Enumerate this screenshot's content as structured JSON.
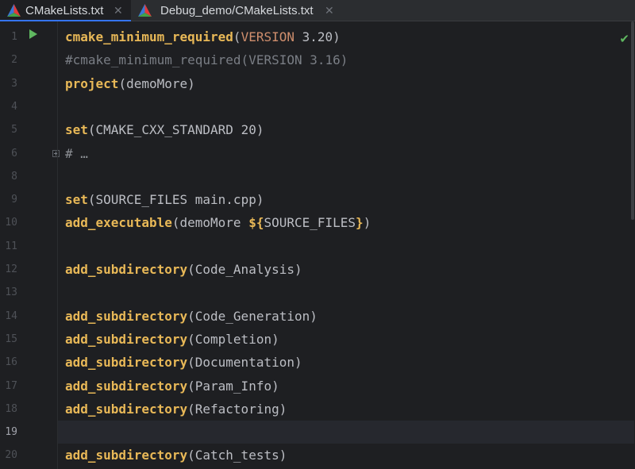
{
  "tabs": [
    {
      "label": "CMakeLists.txt",
      "icon": "cmake-icon",
      "active": true,
      "close": "✕"
    },
    {
      "label": "Debug_demo/CMakeLists.txt",
      "icon": "cmake-icon",
      "active": false,
      "close": "✕"
    }
  ],
  "colors": {
    "function": "#e8b857",
    "keyword": "#cf8e6d",
    "comment": "#7a7e85",
    "variable": "#c77dbb",
    "text": "#bcbec4",
    "run_icon": "#5fb760",
    "background": "#1e1f22"
  },
  "editor": {
    "current_line": "19",
    "inspection_status": "✔",
    "lines": [
      {
        "num": "1",
        "tokens": [
          {
            "t": "cmake_minimum_required",
            "c": "fn"
          },
          {
            "t": "(",
            "c": ""
          },
          {
            "t": "VERSION",
            "c": "kw"
          },
          {
            "t": " 3.20)",
            "c": ""
          }
        ]
      },
      {
        "num": "2",
        "tokens": [
          {
            "t": "#cmake_minimum_required(VERSION 3.16)",
            "c": "cm"
          }
        ]
      },
      {
        "num": "3",
        "tokens": [
          {
            "t": "project",
            "c": "fn"
          },
          {
            "t": "(demoMore)",
            "c": ""
          }
        ]
      },
      {
        "num": "4",
        "tokens": []
      },
      {
        "num": "5",
        "tokens": [
          {
            "t": "set",
            "c": "fn"
          },
          {
            "t": "(CMAKE_CXX_STANDARD 20)",
            "c": ""
          }
        ]
      },
      {
        "num": "6",
        "tokens": [
          {
            "t": "# …",
            "c": "fold-placeholder"
          }
        ]
      },
      {
        "num": "8",
        "tokens": []
      },
      {
        "num": "9",
        "tokens": [
          {
            "t": "set",
            "c": "fn"
          },
          {
            "t": "(SOURCE_FILES main.cpp)",
            "c": ""
          }
        ]
      },
      {
        "num": "10",
        "tokens": [
          {
            "t": "add_executable",
            "c": "fn"
          },
          {
            "t": "(demoMore ",
            "c": ""
          },
          {
            "t": "${",
            "c": "fn"
          },
          {
            "t": "SOURCE_FILES",
            "c": ""
          },
          {
            "t": "}",
            "c": "fn"
          },
          {
            "t": ")",
            "c": ""
          }
        ]
      },
      {
        "num": "11",
        "tokens": []
      },
      {
        "num": "12",
        "tokens": [
          {
            "t": "add_subdirectory",
            "c": "fn"
          },
          {
            "t": "(Code_Analysis)",
            "c": ""
          }
        ]
      },
      {
        "num": "13",
        "tokens": []
      },
      {
        "num": "14",
        "tokens": [
          {
            "t": "add_subdirectory",
            "c": "fn"
          },
          {
            "t": "(Code_Generation)",
            "c": ""
          }
        ]
      },
      {
        "num": "15",
        "tokens": [
          {
            "t": "add_subdirectory",
            "c": "fn"
          },
          {
            "t": "(Completion)",
            "c": ""
          }
        ]
      },
      {
        "num": "16",
        "tokens": [
          {
            "t": "add_subdirectory",
            "c": "fn"
          },
          {
            "t": "(Documentation)",
            "c": ""
          }
        ]
      },
      {
        "num": "17",
        "tokens": [
          {
            "t": "add_subdirectory",
            "c": "fn"
          },
          {
            "t": "(Param_Info)",
            "c": ""
          }
        ]
      },
      {
        "num": "18",
        "tokens": [
          {
            "t": "add_subdirectory",
            "c": "fn"
          },
          {
            "t": "(Refactoring)",
            "c": ""
          }
        ]
      },
      {
        "num": "19",
        "tokens": []
      },
      {
        "num": "20",
        "tokens": [
          {
            "t": "add_subdirectory",
            "c": "fn"
          },
          {
            "t": "(Catch_tests)",
            "c": ""
          }
        ]
      }
    ]
  }
}
